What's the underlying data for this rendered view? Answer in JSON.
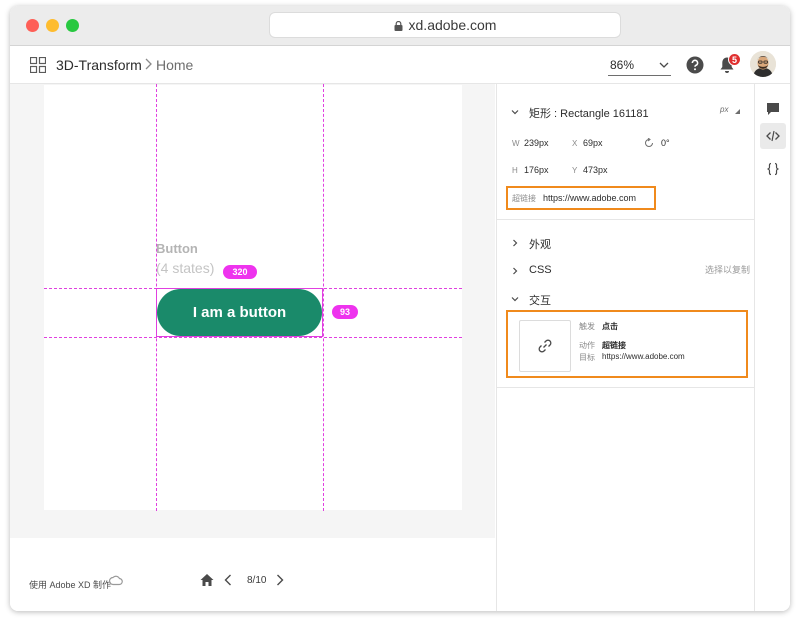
{
  "browser": {
    "url": "xd.adobe.com"
  },
  "header": {
    "project": "3D-Transform",
    "page": "Home",
    "zoom": "86%",
    "notifications": "5"
  },
  "canvas": {
    "component_title": "Button",
    "component_subtitle": "(4 states)",
    "width_measure": "320",
    "height_measure": "93",
    "button_label": "I am a button"
  },
  "footer": {
    "made_with": "使用 Adobe XD 制作",
    "page_indicator": "8/10"
  },
  "inspect": {
    "layer_title": "矩形 : Rectangle 161181",
    "unit": "px",
    "w_label": "W",
    "w_value": "239px",
    "x_label": "X",
    "x_value": "69px",
    "rotation": "0°",
    "h_label": "H",
    "h_value": "176px",
    "y_label": "Y",
    "y_value": "473px",
    "hyperlink_label": "超链接",
    "hyperlink_value": "https://www.adobe.com",
    "sections": {
      "appearance": "外观",
      "css": "CSS",
      "css_hint": "选择以复制",
      "interaction": "交互"
    },
    "interaction": {
      "trigger_label": "触发",
      "trigger_value": "点击",
      "action_label": "动作",
      "action_value": "超链接",
      "target_label": "目标",
      "target_value": "https://www.adobe.com"
    }
  },
  "colors": {
    "accent_button": "#1a8a6a",
    "guide": "#e040e0",
    "highlight": "#f08a1c",
    "badge": "#e03030"
  }
}
